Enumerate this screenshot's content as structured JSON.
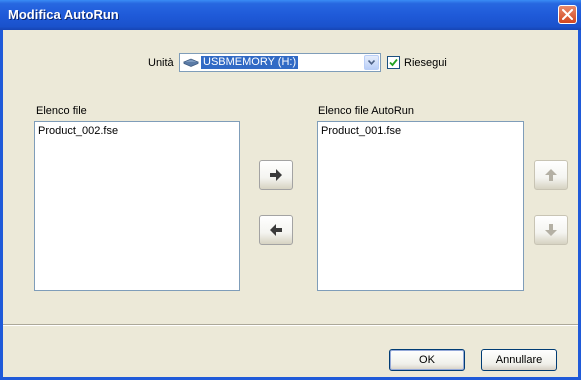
{
  "window": {
    "title": "Modifica AutoRun"
  },
  "drive": {
    "label": "Unità",
    "selected": "USBMEMORY (H:)",
    "icon": "usb-drive-icon"
  },
  "rerun": {
    "label": "Riesegui",
    "checked": true
  },
  "file_list": {
    "label": "Elenco file",
    "items": [
      "Product_002.fse"
    ]
  },
  "autorun_list": {
    "label": "Elenco file AutoRun",
    "items": [
      "Product_001.fse"
    ]
  },
  "buttons": {
    "ok": "OK",
    "cancel": "Annullare"
  },
  "icons": {
    "move_right": "arrow-right-icon",
    "move_left": "arrow-left-icon",
    "move_up": "arrow-up-icon",
    "move_down": "arrow-down-icon",
    "close": "close-icon"
  },
  "colors": {
    "titlebar": "#1F5AD9",
    "selection": "#316AC5",
    "dialog_bg": "#ECE9D8",
    "close_button": "#D2461F"
  }
}
